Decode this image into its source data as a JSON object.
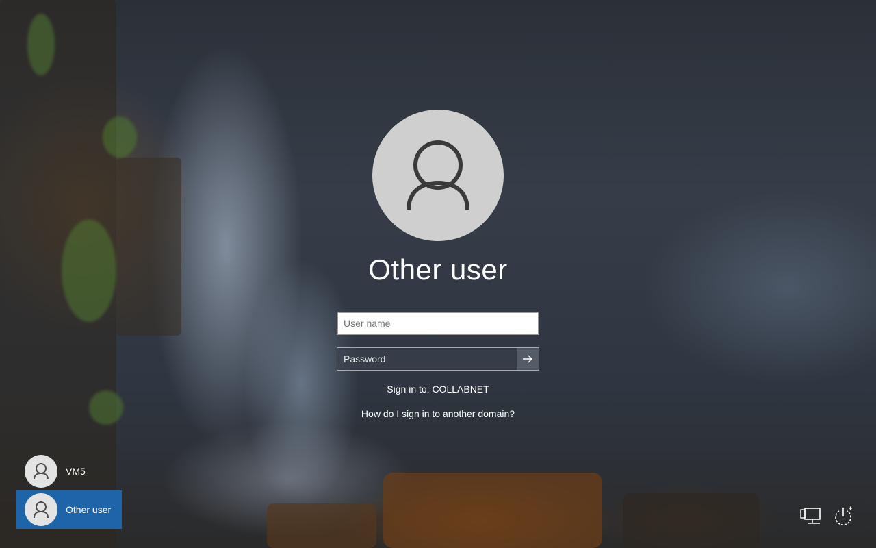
{
  "login": {
    "user_title": "Other user",
    "username_placeholder": "User name",
    "password_placeholder": "Password",
    "sign_in_to": "Sign in to: COLLABNET",
    "domain_help": "How do I sign in to another domain?"
  },
  "users": [
    {
      "name": "VM5",
      "selected": false
    },
    {
      "name": "Other user",
      "selected": true
    }
  ],
  "icons": {
    "avatar": "person-icon",
    "submit": "arrow-right-icon",
    "network": "network-icon",
    "power": "power-icon"
  },
  "colors": {
    "selected_user": "#1e64a8",
    "avatar_bg": "#cfcfcf"
  }
}
